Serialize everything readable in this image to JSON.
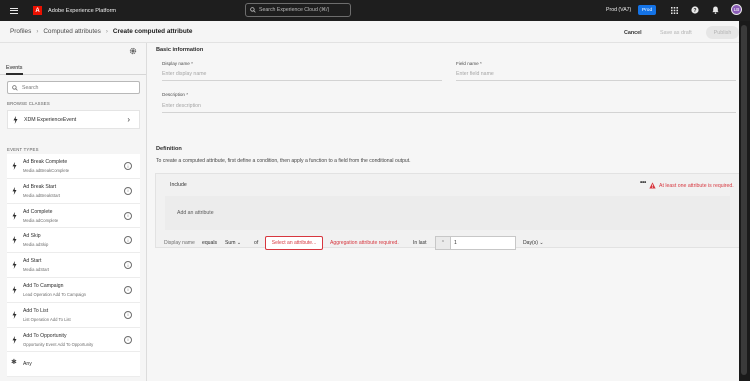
{
  "topbar": {
    "logo_text": "A",
    "app_title": "Adobe Experience Platform",
    "search_placeholder": "Search Experience Cloud (⌘/)",
    "org": "Prod (VA7)",
    "sandbox": "Prod",
    "avatar_initials": "LB",
    "icons": [
      "menu-icon",
      "search-icon",
      "apps-icon",
      "help-icon",
      "bell-icon"
    ]
  },
  "breadcrumb": {
    "items": [
      "Profiles",
      "Computed attributes"
    ],
    "current": "Create computed attribute"
  },
  "actions": {
    "cancel": "Cancel",
    "save_draft": "Save as draft",
    "publish": "Publish"
  },
  "sidebar": {
    "tab": "Events",
    "search_placeholder": "Search",
    "browse_classes_label": "BROWSE CLASSES",
    "class_item": "XDM ExperienceEvent",
    "event_types_label": "EVENT TYPES",
    "events": [
      {
        "title": "Ad Break Complete",
        "subtitle": "Media adBreakComplete"
      },
      {
        "title": "Ad Break Start",
        "subtitle": "Media adBreakStart"
      },
      {
        "title": "Ad Complete",
        "subtitle": "Media adComplete"
      },
      {
        "title": "Ad Skip",
        "subtitle": "Media adSkip"
      },
      {
        "title": "Ad Start",
        "subtitle": "Media adStart"
      },
      {
        "title": "Add To Campaign",
        "subtitle": "Lead Operation Add To Campaign"
      },
      {
        "title": "Add To List",
        "subtitle": "List Operation Add To List"
      },
      {
        "title": "Add To Opportunity",
        "subtitle": "Opportunity Event Add To Opportunity"
      }
    ],
    "any_label": "Any"
  },
  "basic": {
    "heading": "Basic information",
    "display_name_label": "Display name *",
    "display_name_placeholder": "Enter display name",
    "field_name_label": "Field name *",
    "field_name_placeholder": "Enter field name",
    "description_label": "Description *",
    "description_placeholder": "Enter description"
  },
  "definition": {
    "heading": "Definition",
    "description": "To create a computed attribute, first define a condition, then apply a function to a field from the conditional output.",
    "include_label": "Include",
    "more": "•••",
    "error_top": "At least one attribute is required.",
    "add_attribute": "Add an attribute",
    "function_row": {
      "name": "Display name",
      "equals": "equals",
      "function": "Sum",
      "of": "of",
      "select_attribute": "Select an attribute...",
      "error": "Aggregation attribute required.",
      "in_last": "In last",
      "value": "1",
      "unit": "Day(s)"
    }
  },
  "colors": {
    "accent": "#1473e6",
    "error": "#d7373f",
    "adobe_red": "#eb1000"
  }
}
